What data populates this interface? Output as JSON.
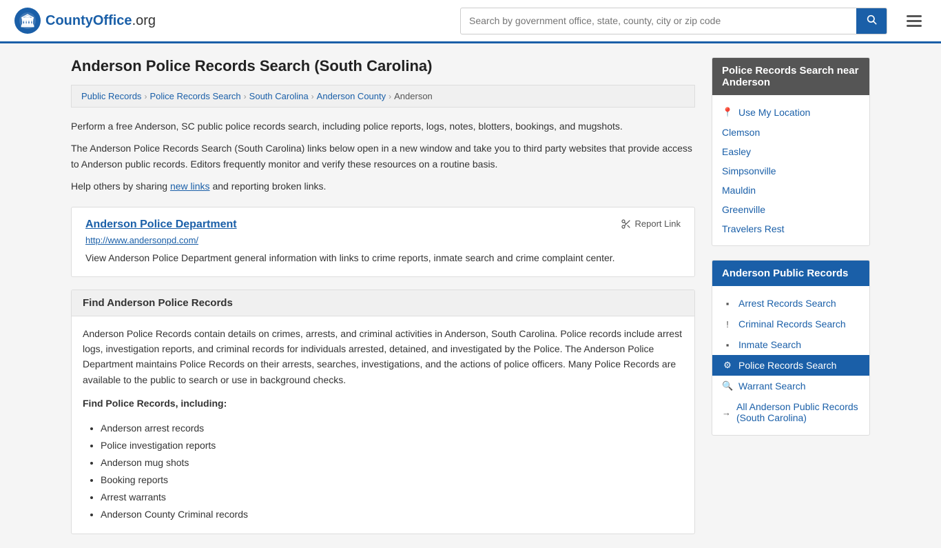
{
  "header": {
    "logo_text": "CountyOffice",
    "logo_suffix": ".org",
    "search_placeholder": "Search by government office, state, county, city or zip code",
    "search_value": ""
  },
  "page": {
    "title": "Anderson Police Records Search (South Carolina)"
  },
  "breadcrumb": {
    "items": [
      {
        "label": "Public Records",
        "href": "#"
      },
      {
        "label": "Police Records Search",
        "href": "#"
      },
      {
        "label": "South Carolina",
        "href": "#"
      },
      {
        "label": "Anderson County",
        "href": "#"
      },
      {
        "label": "Anderson",
        "href": "#"
      }
    ]
  },
  "description": {
    "paragraph1": "Perform a free Anderson, SC public police records search, including police reports, logs, notes, blotters, bookings, and mugshots.",
    "paragraph2": "The Anderson Police Records Search (South Carolina) links below open in a new window and take you to third party websites that provide access to Anderson public records. Editors frequently monitor and verify these resources on a routine basis.",
    "paragraph3_pre": "Help others by sharing ",
    "paragraph3_link": "new links",
    "paragraph3_post": " and reporting broken links."
  },
  "resource": {
    "title": "Anderson Police Department",
    "url": "http://www.andersonpd.com/",
    "desc": "View Anderson Police Department general information with links to crime reports, inmate search and crime complaint center.",
    "report_link_label": "Report Link"
  },
  "find_section": {
    "header": "Find Anderson Police Records",
    "body": "Anderson Police Records contain details on crimes, arrests, and criminal activities in Anderson, South Carolina. Police records include arrest logs, investigation reports, and criminal records for individuals arrested, detained, and investigated by the Police. The Anderson Police Department maintains Police Records on their arrests, searches, investigations, and the actions of police officers. Many Police Records are available to the public to search or use in background checks.",
    "includes_title": "Find Police Records, including:",
    "list": [
      "Anderson arrest records",
      "Police investigation reports",
      "Anderson mug shots",
      "Booking reports",
      "Arrest warrants",
      "Anderson County Criminal records"
    ]
  },
  "sidebar": {
    "nearby_section_title": "Police Records Search near Anderson",
    "use_my_location_label": "Use My Location",
    "nearby_links": [
      "Clemson",
      "Easley",
      "Simpsonville",
      "Mauldin",
      "Greenville",
      "Travelers Rest"
    ],
    "public_records_title": "Anderson Public Records",
    "public_records_links": [
      {
        "label": "Arrest Records Search",
        "icon": "▪",
        "active": false
      },
      {
        "label": "Criminal Records Search",
        "icon": "!",
        "active": false
      },
      {
        "label": "Inmate Search",
        "icon": "▪",
        "active": false
      },
      {
        "label": "Police Records Search",
        "icon": "⚙",
        "active": true
      },
      {
        "label": "Warrant Search",
        "icon": "🔍",
        "active": false
      },
      {
        "label": "All Anderson Public Records (South Carolina)",
        "icon": "→",
        "active": false
      }
    ]
  }
}
